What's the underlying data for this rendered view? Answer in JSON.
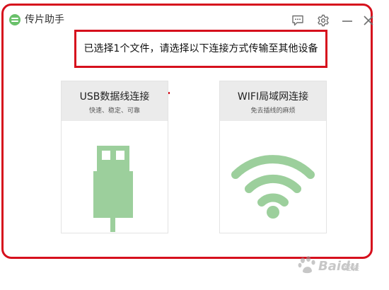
{
  "window": {
    "title": "传片助手"
  },
  "message": {
    "text": "已选择1个文件，请选择以下连接方式传输至其他设备"
  },
  "options": {
    "usb": {
      "title": "USB数据线连接",
      "subtitle": "快速、稳定、可靠",
      "icon": "usb-plug-icon"
    },
    "wifi": {
      "title": "WIFI局域网连接",
      "subtitle": "免去插线的麻烦",
      "icon": "wifi-icon"
    }
  },
  "watermark": {
    "brand": "Baidu",
    "sub": "经验"
  },
  "colors": {
    "highlight_red": "#d6101d",
    "accent_green": "#9ccf9c",
    "logo_green": "#69c06a",
    "card_header_bg": "#ebebeb"
  }
}
